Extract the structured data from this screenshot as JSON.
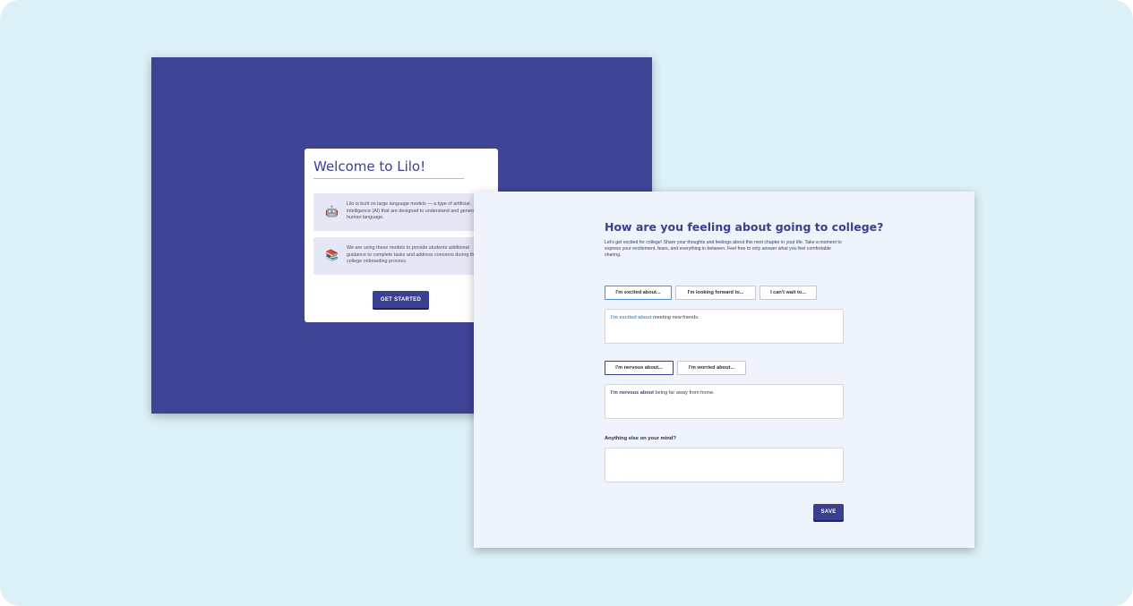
{
  "welcome": {
    "title": "Welcome to Lilo!",
    "info": [
      {
        "icon": "robot-icon",
        "glyph": "🤖",
        "text": "Lilo is built on large language models — a type of artificial intelligence (AI) that are designed to understand and generate human language."
      },
      {
        "icon": "books-icon",
        "glyph": "📚",
        "text": "We are using these models to provide students additional guidance to complete tasks and address concerns during the college onboarding process."
      }
    ],
    "button": "GET STARTED"
  },
  "form": {
    "title": "How are you feeling about going to college?",
    "intro": "Let's get excited for college! Share your thoughts and feelings about this next chapter in your life. Take a moment to express your excitement, fears, and everything in between. Feel free to only answer what you feel comfortable sharing.",
    "group1": {
      "chips": [
        "I'm excited about...",
        "I'm looking forward to...",
        "I can't wait to..."
      ],
      "answer_keyword": "I'm excited about",
      "answer_rest": " meeting new friends."
    },
    "group2": {
      "chips": [
        "I'm nervous about...",
        "I'm worried about..."
      ],
      "answer_keyword": "I'm nervous about",
      "answer_rest": " being far away from home."
    },
    "anything_else_label": "Anything else on your mind?",
    "anything_else_value": "",
    "save": "SAVE"
  },
  "colors": {
    "background": "#dcf0f8",
    "brand_navy": "#3f4395",
    "accent_blue": "#3d9ae0",
    "form_bg": "#eff3fc"
  }
}
